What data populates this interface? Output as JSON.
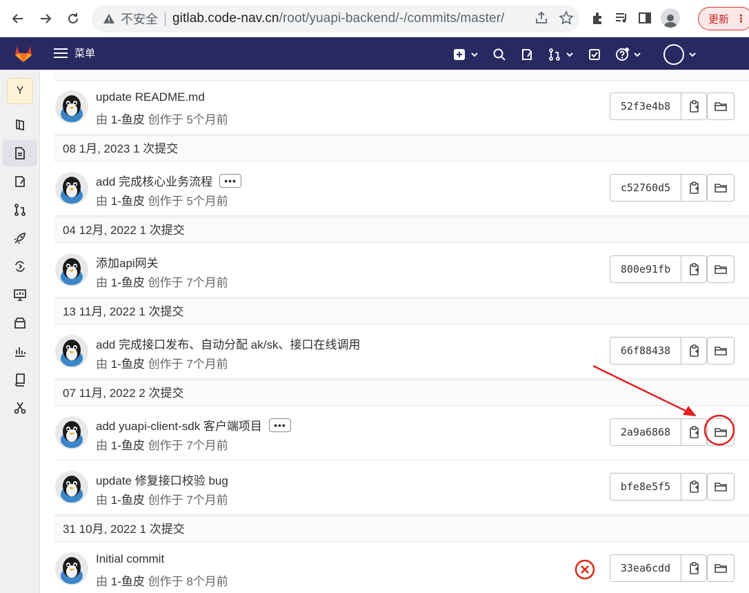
{
  "browser": {
    "insecure_label": "不安全",
    "url_host": "gitlab.code-nav.cn",
    "url_path": "/root/yuapi-backend/-/commits/master/",
    "update_label": "更新",
    "update_more": "⋮"
  },
  "gitlab_nav": {
    "menu_label": "菜单"
  },
  "sidebar": {
    "project_initial": "Y"
  },
  "day_headers": [
    {
      "label": "08 1月, 2023 1 次提交"
    },
    {
      "label": "04 12月, 2022 1 次提交"
    },
    {
      "label": "13 11月, 2022 1 次提交"
    },
    {
      "label": "07 11月, 2022 2 次提交"
    },
    {
      "label": "31 10月, 2022 1 次提交"
    }
  ],
  "commits": [
    {
      "title": "update README.md",
      "author_prefix": "由",
      "author": "1-鱼皮",
      "created": "创作于 5个月前",
      "sha": "52f3e4b8",
      "more": ""
    },
    {
      "title": "add 完成核心业务流程",
      "author_prefix": "由",
      "author": "1-鱼皮",
      "created": "创作于 5个月前",
      "sha": "c52760d5",
      "more": "•••"
    },
    {
      "title": "添加api网关",
      "author_prefix": "由",
      "author": "1-鱼皮",
      "created": "创作于 7个月前",
      "sha": "800e91fb",
      "more": ""
    },
    {
      "title": "add 完成接口发布、自动分配 ak/sk、接口在线调用",
      "author_prefix": "由",
      "author": "1-鱼皮",
      "created": "创作于 7个月前",
      "sha": "66f88438",
      "more": ""
    },
    {
      "title": "add yuapi-client-sdk 客户端项目",
      "author_prefix": "由",
      "author": "1-鱼皮",
      "created": "创作于 7个月前",
      "sha": "2a9a6868",
      "more": "•••"
    },
    {
      "title": "update 修复接口校验 bug",
      "author_prefix": "由",
      "author": "1-鱼皮",
      "created": "创作于 7个月前",
      "sha": "bfe8e5f5",
      "more": ""
    },
    {
      "title": "Initial commit",
      "author_prefix": "由",
      "author": "1-鱼皮",
      "created": "创作于 8个月前",
      "sha": "33ea6cdd",
      "more": "",
      "pipeline_status": "failed"
    }
  ],
  "colors": {
    "gitlab_nav": "#292961",
    "annotation": "#e02020",
    "pipeline_failed": "#dd2b0e"
  }
}
